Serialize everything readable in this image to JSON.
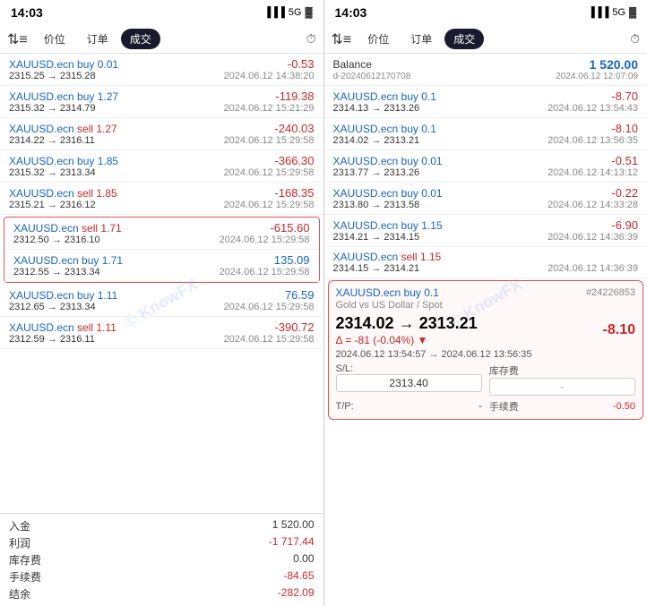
{
  "left": {
    "statusBar": {
      "time": "14:03",
      "signal": "▐▐▐",
      "network": "5G",
      "battery": "🔋"
    },
    "tabs": {
      "sort": "⇅",
      "items": [
        "价位",
        "订单",
        "成交"
      ],
      "activeIndex": 2,
      "clock": "🕐"
    },
    "trades": [
      {
        "symbol": "XAUUSD.ecn",
        "action": "buy",
        "size": "0.01",
        "priceFrom": "2315.25",
        "priceTo": "2315.28",
        "time": "2024.06.12 14:38:20",
        "profit": "-0.53",
        "profitType": "negative",
        "highlighted": false
      },
      {
        "symbol": "XAUUSD.ecn",
        "action": "buy",
        "size": "1.27",
        "priceFrom": "2315.32",
        "priceTo": "2314.79",
        "time": "2024.06.12 15:21:29",
        "profit": "-119.38",
        "profitType": "negative",
        "highlighted": false
      },
      {
        "symbol": "XAUUSD.ecn",
        "action": "sell",
        "size": "1.27",
        "priceFrom": "2314.22",
        "priceTo": "2316.11",
        "time": "2024.06.12 15:29:58",
        "profit": "-240.03",
        "profitType": "negative",
        "highlighted": false
      },
      {
        "symbol": "XAUUSD.ecn",
        "action": "buy",
        "size": "1.85",
        "priceFrom": "2315.32",
        "priceTo": "2313.34",
        "time": "2024.06.12 15:29:58",
        "profit": "-366.30",
        "profitType": "negative",
        "highlighted": false
      },
      {
        "symbol": "XAUUSD.ecn",
        "action": "sell",
        "size": "1.85",
        "priceFrom": "2315.21",
        "priceTo": "2316.12",
        "time": "2024.06.12 15:29:58",
        "profit": "-168.35",
        "profitType": "negative",
        "highlighted": false
      },
      {
        "symbol": "XAUUSD.ecn",
        "action": "sell",
        "size": "1.71",
        "priceFrom": "2312.50",
        "priceTo": "2316.10",
        "time": "2024.06.12 15:29:58",
        "profit": "-615.60",
        "profitType": "negative",
        "highlighted": true
      },
      {
        "symbol": "XAUUSD.ecn",
        "action": "buy",
        "size": "1.71",
        "priceFrom": "2312.55",
        "priceTo": "2313.34",
        "time": "2024.06.12 15:29:58",
        "profit": "135.09",
        "profitType": "positive",
        "highlighted": true
      },
      {
        "symbol": "XAUUSD.ecn",
        "action": "buy",
        "size": "1.11",
        "priceFrom": "2312.65",
        "priceTo": "2313.34",
        "time": "2024.06.12 15:29:58",
        "profit": "76.59",
        "profitType": "positive",
        "highlighted": false
      },
      {
        "symbol": "XAUUSD.ecn",
        "action": "sell",
        "size": "1.11",
        "priceFrom": "2312.59",
        "priceTo": "2316.11",
        "time": "2024.06.12 15:29:58",
        "profit": "-390.72",
        "profitType": "negative",
        "highlighted": false
      }
    ],
    "summary": [
      {
        "label": "入金",
        "value": "1 520.00",
        "type": "normal"
      },
      {
        "label": "利润",
        "value": "-1 717.44",
        "type": "negative"
      },
      {
        "label": "库存费",
        "value": "0.00",
        "type": "normal"
      },
      {
        "label": "手续费",
        "value": "-84.65",
        "type": "negative"
      },
      {
        "label": "结余",
        "value": "-282.09",
        "type": "negative"
      }
    ]
  },
  "right": {
    "statusBar": {
      "time": "14:03",
      "signal": "▐▐▐",
      "network": "5G",
      "battery": "🔋"
    },
    "tabs": {
      "sort": "⇅",
      "items": [
        "价位",
        "订单",
        "成交"
      ],
      "activeIndex": 2,
      "clock": "🕐"
    },
    "balance": {
      "label": "Balance",
      "value": "1 520.00",
      "id": "d-20240612170708",
      "time": "2024.06.12 12:07:09"
    },
    "trades": [
      {
        "symbol": "XAUUSD.ecn",
        "action": "buy",
        "size": "0.1",
        "priceFrom": "2314.13",
        "priceTo": "2313.26",
        "time": "2024.06.12 13:54:43",
        "profit": "-8.70",
        "profitType": "negative",
        "highlighted": false
      },
      {
        "symbol": "XAUUSD.ecn",
        "action": "buy",
        "size": "0.1",
        "priceFrom": "2314.02",
        "priceTo": "2313.21",
        "time": "2024.06.12 13:56:35",
        "profit": "-8.10",
        "profitType": "negative",
        "highlighted": false
      },
      {
        "symbol": "XAUUSD.ecn",
        "action": "buy",
        "size": "0.01",
        "priceFrom": "2313.77",
        "priceTo": "2313.26",
        "time": "2024.06.12 14:13:12",
        "profit": "-0.51",
        "profitType": "negative",
        "highlighted": false
      },
      {
        "symbol": "XAUUSD.ecn",
        "action": "buy",
        "size": "0.01",
        "priceFrom": "2313.80",
        "priceTo": "2313.58",
        "time": "2024.06.12 14:33:28",
        "profit": "-0.22",
        "profitType": "negative",
        "highlighted": false
      },
      {
        "symbol": "XAUUSD.ecn",
        "action": "buy",
        "size": "1.15",
        "priceFrom": "2314.21",
        "priceTo": "2314.15",
        "time": "2024.06.12 14:36:39",
        "profit": "-6.90",
        "profitType": "negative",
        "highlighted": false
      },
      {
        "symbol": "XAUUSD.ecn",
        "action": "sell",
        "size": "1.15",
        "priceFrom": "2314.15",
        "priceTo": "2314.21",
        "time": "2024.06.12 14:36:39",
        "profit": "",
        "profitType": "normal",
        "highlighted": false
      }
    ],
    "detail": {
      "symbol": "XAUUSD.ecn",
      "action": "buy",
      "size": "0.1",
      "orderNum": "#24226853",
      "subtitle": "Gold vs US Dollar / Spot",
      "priceFrom": "2314.02",
      "priceTo": "2313.21",
      "delta": "Δ = -81 (-0.04%)",
      "deltaDir": "▼",
      "timeFrom": "2024.06.12 13:54:57",
      "timeTo": "2024.06.12 13:56:35",
      "sl": "2313.40",
      "tp": "-",
      "storage": "-",
      "commission": "-0.50",
      "profit": "-8.10",
      "profitType": "negative"
    }
  }
}
